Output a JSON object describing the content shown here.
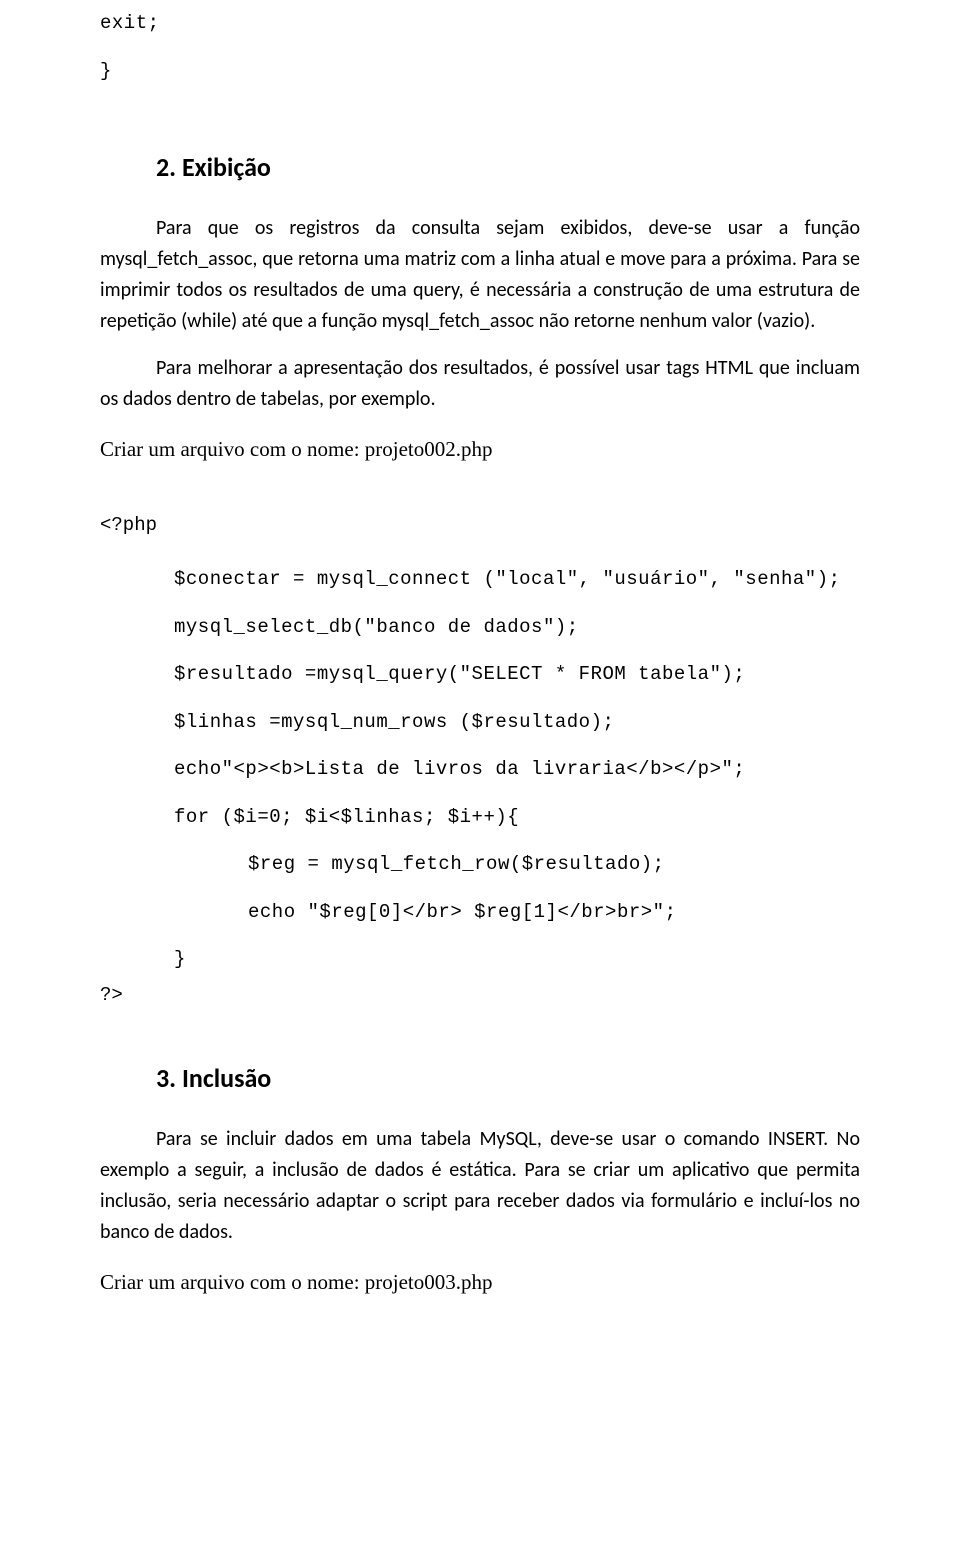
{
  "top_code": {
    "line1": "exit;",
    "line2": "}"
  },
  "section2": {
    "heading": "2. Exibição",
    "paragraph1": "Para que os registros da consulta sejam exibidos, deve-se usar a função mysql_fetch_assoc, que retorna uma matriz com a linha atual e move para a próxima. Para se imprimir todos os resultados de uma query, é necessária a construção de uma estrutura de repetição (while) até que a função mysql_fetch_assoc não retorne nenhum valor (vazio).",
    "paragraph2": "Para melhorar a apresentação dos resultados, é possível usar tags HTML que incluam os dados dentro de tabelas, por exemplo.",
    "filename": "Criar um arquivo com o nome: projeto002.php"
  },
  "code2": {
    "open": "<?php",
    "l1": "$conectar = mysql_connect (\"local\", \"usuário\", \"senha\");",
    "l2": "mysql_select_db(\"banco de dados\");",
    "l3": "$resultado =mysql_query(\"SELECT * FROM tabela\");",
    "l4": "$linhas =mysql_num_rows ($resultado);",
    "l5": "echo\"<p><b>Lista de livros da livraria</b></p>\";",
    "l6": "for ($i=0; $i<$linhas; $i++){",
    "l7": "$reg = mysql_fetch_row($resultado);",
    "l8": "echo \"$reg[0]</br> $reg[1]</br>br>\";",
    "l9": "}",
    "close": "?>"
  },
  "section3": {
    "heading": "3. Inclusão",
    "paragraph1": "Para se incluir dados em uma tabela MySQL, deve-se usar o comando INSERT. No exemplo a seguir, a inclusão de dados é estática. Para se criar um aplicativo que permita inclusão, seria necessário adaptar o script para receber dados via formulário e incluí-los no banco de dados.",
    "filename": "Criar um arquivo com o nome: projeto003.php"
  }
}
